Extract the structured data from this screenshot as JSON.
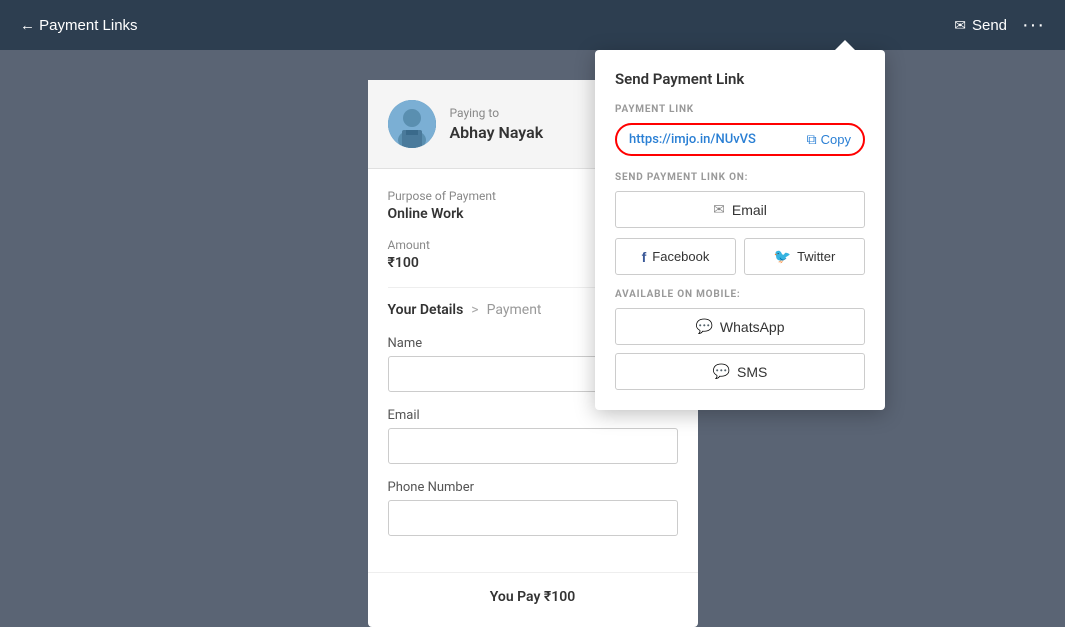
{
  "header": {
    "back_label": "← Payment Links",
    "send_label": "Send",
    "dots_label": "···"
  },
  "payment_card": {
    "paying_to_label": "Paying to",
    "paying_to_name": "Abhay Nayak",
    "purpose_label": "Purpose of Payment",
    "purpose_value": "Online Work",
    "amount_label": "Amount",
    "amount_value": "₹100",
    "step_your_details": "Your Details",
    "step_chevron": ">",
    "step_payment": "Payment",
    "name_label": "Name",
    "name_placeholder": "",
    "email_label": "Email",
    "email_placeholder": "",
    "phone_label": "Phone Number",
    "phone_placeholder": "",
    "footer_text": "You Pay ₹100"
  },
  "send_panel": {
    "title": "Send Payment Link",
    "link_section_label": "PAYMENT LINK",
    "link_url": "https://imjo.in/NUvVS",
    "copy_label": "Copy",
    "send_on_label": "SEND PAYMENT LINK ON:",
    "email_btn_label": "Email",
    "facebook_btn_label": "Facebook",
    "twitter_btn_label": "Twitter",
    "mobile_label": "AVAILABLE ON MOBILE:",
    "whatsapp_btn_label": "WhatsApp",
    "sms_btn_label": "SMS"
  }
}
